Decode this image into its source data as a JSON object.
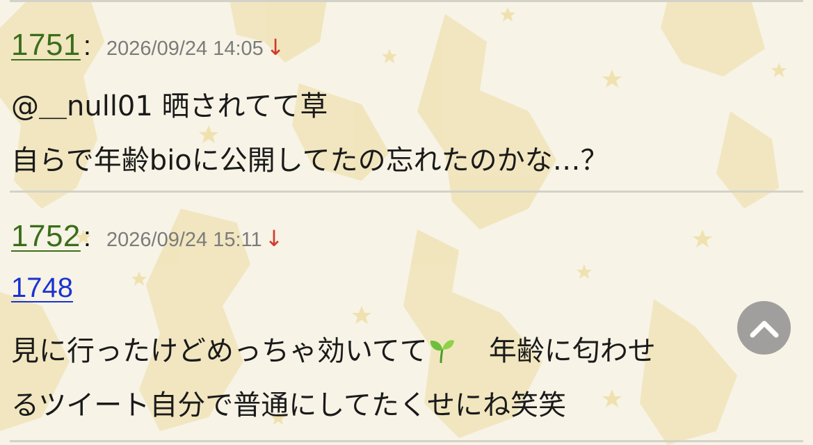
{
  "posts": [
    {
      "number": "1751",
      "date": "2026/09/24 14:05",
      "arrow": "↓",
      "lines": [
        "@＿null01 晒されてて草",
        "自らで年齢bioに公開してたの忘れたのかな…？"
      ]
    },
    {
      "number": "1752",
      "date": "2026/09/24 15:11",
      "arrow": "↓",
      "reply_link": "1748",
      "lines": [
        "見に行ったけどめっちゃ効いてて",
        "年齢に匂わせ",
        "るツイート自分で普通にしてたくせにね笑笑"
      ]
    }
  ],
  "colon": ":",
  "icons": {
    "sprout": "sprout-emoji-icon",
    "scroll_top": "chevron-up-icon"
  },
  "colors": {
    "post_number": "#3a6e1a",
    "reply_link": "#1a32d2",
    "date": "#7b7b7b",
    "arrow": "#d23a2b",
    "background": "#f7f3e6"
  }
}
